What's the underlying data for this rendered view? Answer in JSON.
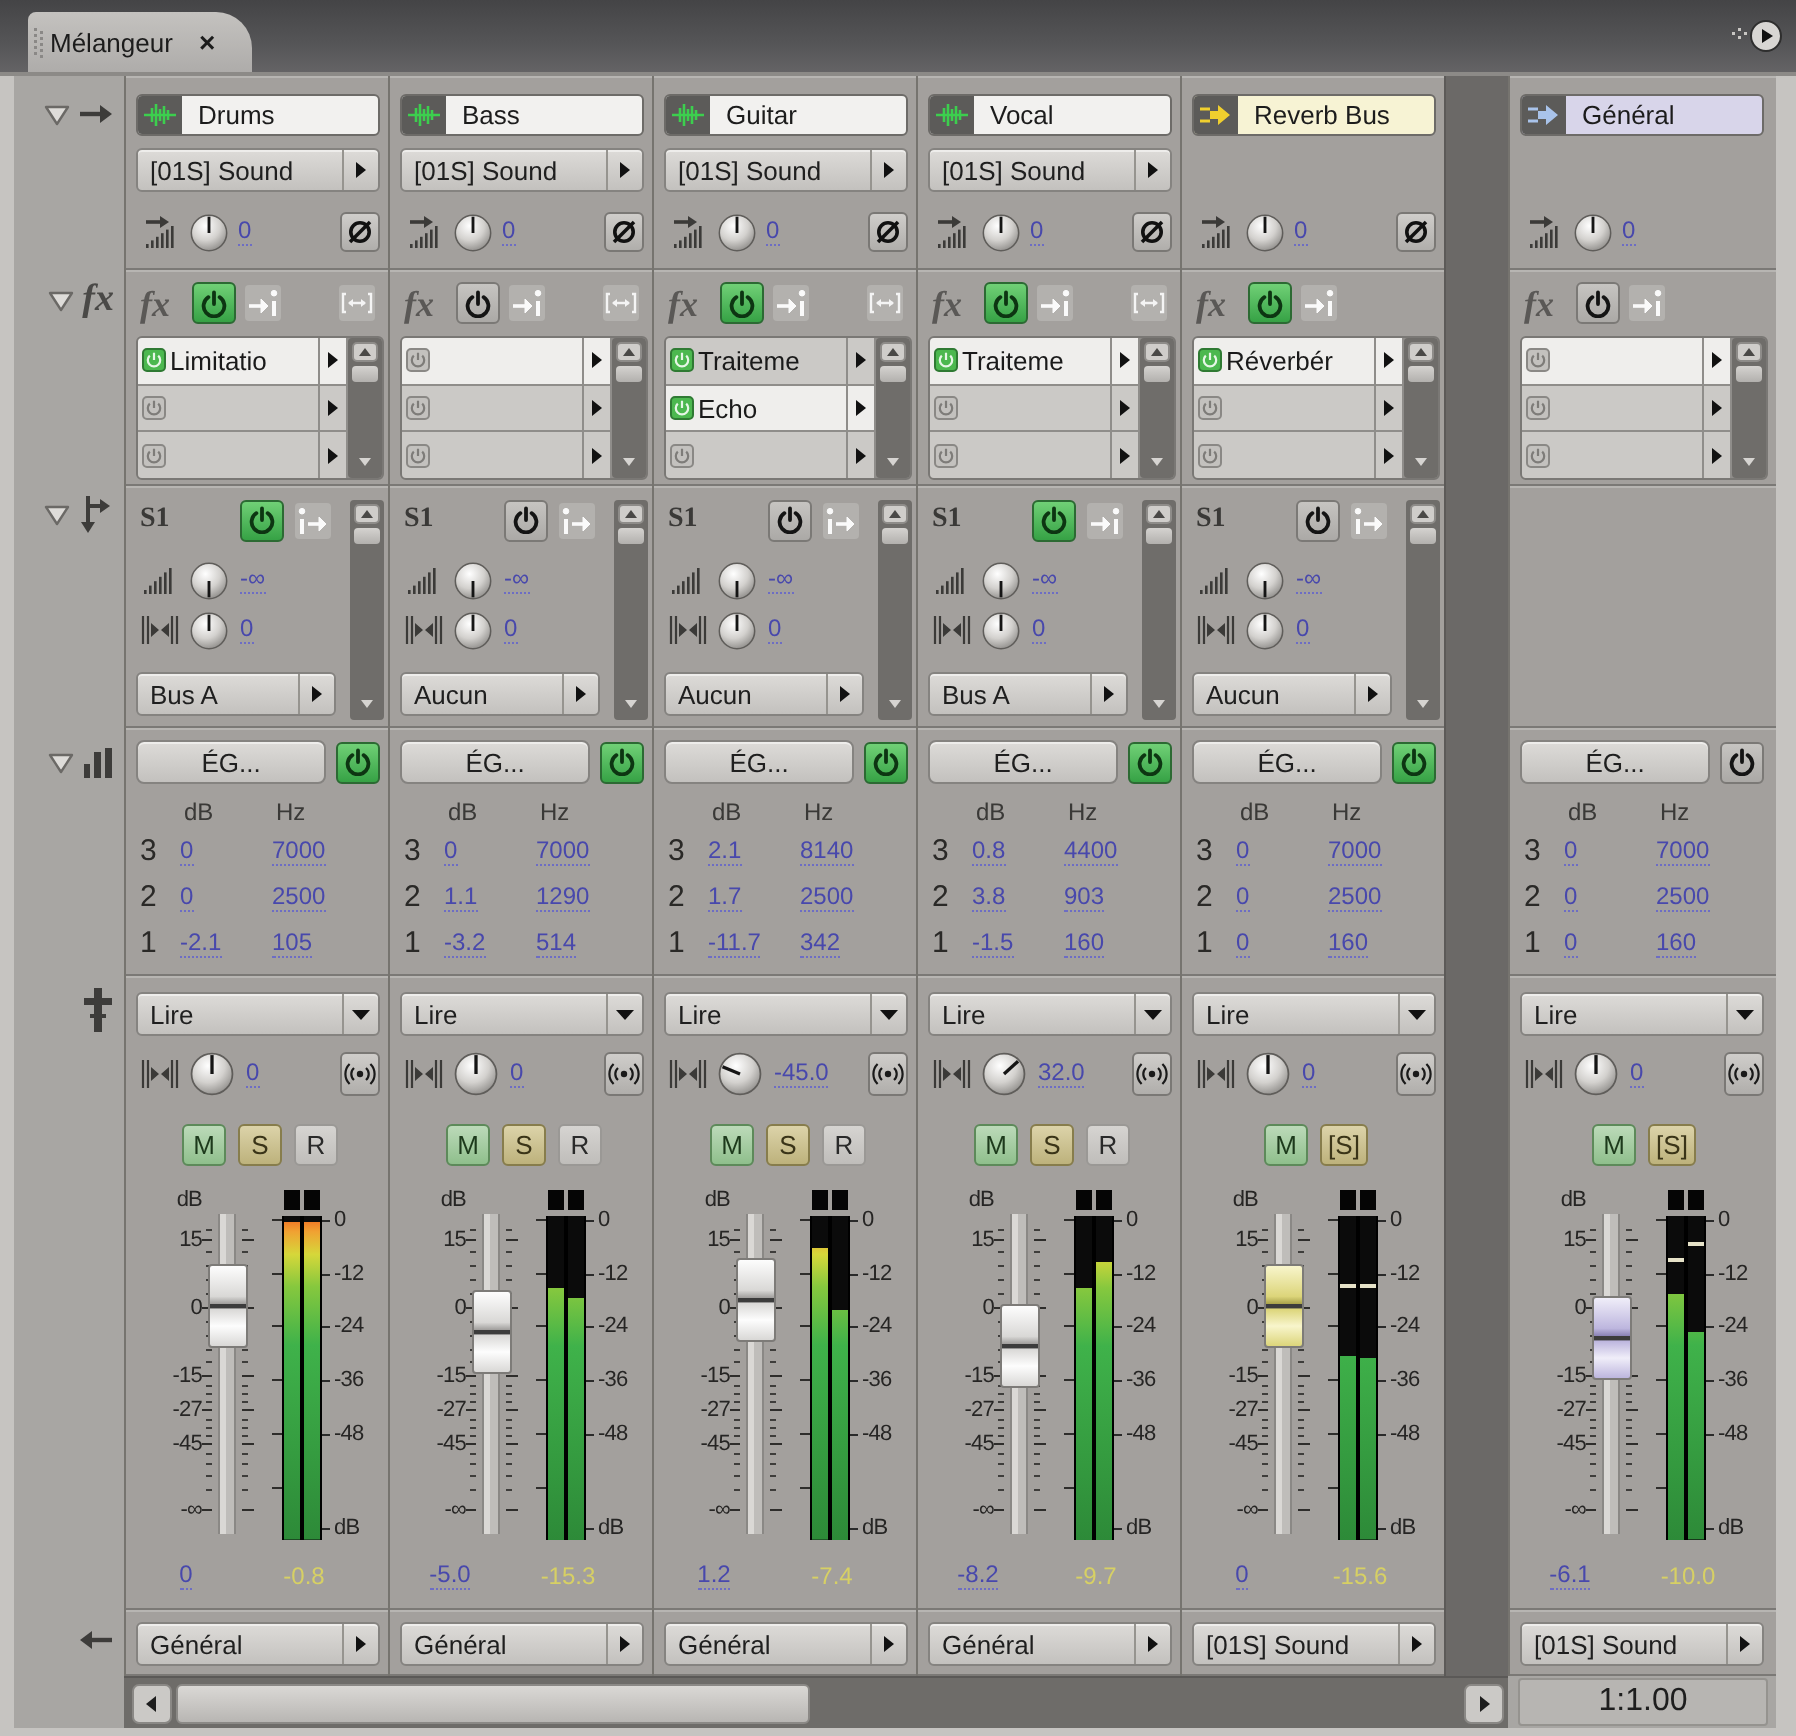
{
  "panel": {
    "tab": {
      "title": "Mélangeur",
      "close": "×",
      "selected": true
    }
  },
  "row_headers": [
    {
      "kind": "input",
      "expanded": true
    },
    {
      "kind": "effects",
      "label": "fx",
      "expanded": true
    },
    {
      "kind": "sends",
      "expanded": true
    },
    {
      "kind": "eq",
      "expanded": true
    },
    {
      "kind": "automation"
    },
    {
      "kind": "output"
    }
  ],
  "channels": [
    {
      "kind": "track",
      "name": "Drums",
      "input": "[01S] Sound",
      "gain": "0",
      "phase_invert": false,
      "fx": {
        "label": "fx",
        "power": true,
        "slots": [
          {
            "name": "Limitatio",
            "on": true,
            "selected": true
          },
          {
            "on": false,
            "selected": false
          },
          {
            "on": false,
            "selected": false
          }
        ]
      },
      "send": {
        "label": "S1",
        "power": true,
        "pre_fader": false,
        "volume": "-∞",
        "pan": "0",
        "bus": "Bus A"
      },
      "eq": {
        "label": "ÉG...",
        "power": true,
        "gain_header": "dB",
        "freq_header": "Hz",
        "bands": [
          {
            "band": "3",
            "gain": "0",
            "freq": "7000"
          },
          {
            "band": "2",
            "gain": "0",
            "freq": "2500"
          },
          {
            "band": "1",
            "gain": "-2.1",
            "freq": "105"
          }
        ]
      },
      "automation": "Lire",
      "pan": "0",
      "buttons": [
        {
          "kind": "mute",
          "label": "M"
        },
        {
          "kind": "solo",
          "label": "S"
        },
        {
          "kind": "record",
          "label": "R"
        }
      ],
      "fader": {
        "unit": "dB",
        "scale": [
          "15",
          "0",
          "-15",
          "-27",
          "-45",
          "-∞"
        ],
        "level": 0.71,
        "value": "0"
      },
      "meter": {
        "scale": [
          "0",
          "-12",
          "-24",
          "-36",
          "-48"
        ],
        "unit": "dB",
        "bars": [
          {
            "level": 0.98
          },
          {
            "level": 0.98
          }
        ],
        "peak": "-0.8"
      },
      "output": "Général"
    },
    {
      "kind": "track",
      "name": "Bass",
      "input": "[01S] Sound",
      "gain": "0",
      "phase_invert": false,
      "fx": {
        "label": "fx",
        "power": false,
        "slots": [
          {
            "on": false,
            "selected": true
          },
          {
            "on": false,
            "selected": false
          },
          {
            "on": false,
            "selected": false
          }
        ]
      },
      "send": {
        "label": "S1",
        "power": false,
        "pre_fader": false,
        "volume": "-∞",
        "pan": "0",
        "bus": "Aucun"
      },
      "eq": {
        "label": "ÉG...",
        "power": true,
        "gain_header": "dB",
        "freq_header": "Hz",
        "bands": [
          {
            "band": "3",
            "gain": "0",
            "freq": "7000"
          },
          {
            "band": "2",
            "gain": "1.1",
            "freq": "1290"
          },
          {
            "band": "1",
            "gain": "-3.2",
            "freq": "514"
          }
        ]
      },
      "automation": "Lire",
      "pan": "0",
      "buttons": [
        {
          "kind": "mute",
          "label": "M"
        },
        {
          "kind": "solo",
          "label": "S"
        },
        {
          "kind": "record",
          "label": "R"
        }
      ],
      "fader": {
        "unit": "dB",
        "scale": [
          "15",
          "0",
          "-15",
          "-27",
          "-45",
          "-∞"
        ],
        "level": 0.63,
        "value": "-5.0"
      },
      "meter": {
        "scale": [
          "0",
          "-12",
          "-24",
          "-36",
          "-48"
        ],
        "unit": "dB",
        "bars": [
          {
            "level": 0.78
          },
          {
            "level": 0.75
          }
        ],
        "peak": "-15.3"
      },
      "output": "Général"
    },
    {
      "kind": "track",
      "name": "Guitar",
      "input": "[01S] Sound",
      "gain": "0",
      "phase_invert": false,
      "fx": {
        "label": "fx",
        "power": true,
        "slots": [
          {
            "name": "Traiteme",
            "on": true,
            "selected": false
          },
          {
            "name": "Echo",
            "on": true,
            "selected": true
          },
          {
            "on": false,
            "selected": false
          }
        ]
      },
      "send": {
        "label": "S1",
        "power": false,
        "pre_fader": false,
        "volume": "-∞",
        "pan": "0",
        "bus": "Aucun"
      },
      "eq": {
        "label": "ÉG...",
        "power": true,
        "gain_header": "dB",
        "freq_header": "Hz",
        "bands": [
          {
            "band": "3",
            "gain": "2.1",
            "freq": "8140"
          },
          {
            "band": "2",
            "gain": "1.7",
            "freq": "2500"
          },
          {
            "band": "1",
            "gain": "-11.7",
            "freq": "342"
          }
        ]
      },
      "automation": "Lire",
      "pan": "-45.0",
      "buttons": [
        {
          "kind": "mute",
          "label": "M"
        },
        {
          "kind": "solo",
          "label": "S"
        },
        {
          "kind": "record",
          "label": "R"
        }
      ],
      "fader": {
        "unit": "dB",
        "scale": [
          "15",
          "0",
          "-15",
          "-27",
          "-45",
          "-∞"
        ],
        "level": 0.73,
        "value": "1.2"
      },
      "meter": {
        "scale": [
          "0",
          "-12",
          "-24",
          "-36",
          "-48"
        ],
        "unit": "dB",
        "bars": [
          {
            "level": 0.9
          },
          {
            "level": 0.71
          }
        ],
        "peak": "-7.4"
      },
      "output": "Général"
    },
    {
      "kind": "track",
      "name": "Vocal",
      "input": "[01S] Sound",
      "gain": "0",
      "phase_invert": false,
      "fx": {
        "label": "fx",
        "power": true,
        "slots": [
          {
            "name": "Traiteme",
            "on": true,
            "selected": true
          },
          {
            "on": false,
            "selected": false
          },
          {
            "on": false,
            "selected": false
          }
        ]
      },
      "send": {
        "label": "S1",
        "power": true,
        "pre_fader": true,
        "volume": "-∞",
        "pan": "0",
        "bus": "Bus A"
      },
      "eq": {
        "label": "ÉG...",
        "power": true,
        "gain_header": "dB",
        "freq_header": "Hz",
        "bands": [
          {
            "band": "3",
            "gain": "0.8",
            "freq": "4400"
          },
          {
            "band": "2",
            "gain": "3.8",
            "freq": "903"
          },
          {
            "band": "1",
            "gain": "-1.5",
            "freq": "160"
          }
        ]
      },
      "automation": "Lire",
      "pan": "32.0",
      "buttons": [
        {
          "kind": "mute",
          "label": "M"
        },
        {
          "kind": "solo",
          "label": "S"
        },
        {
          "kind": "record",
          "label": "R"
        }
      ],
      "fader": {
        "unit": "dB",
        "scale": [
          "15",
          "0",
          "-15",
          "-27",
          "-45",
          "-∞"
        ],
        "level": 0.59,
        "value": "-8.2"
      },
      "meter": {
        "scale": [
          "0",
          "-12",
          "-24",
          "-36",
          "-48"
        ],
        "unit": "dB",
        "bars": [
          {
            "level": 0.78
          },
          {
            "level": 0.86
          }
        ],
        "peak": "-9.7"
      },
      "output": "Général"
    },
    {
      "kind": "bus",
      "name": "Reverb Bus",
      "gain": "0",
      "phase_invert": false,
      "fx": {
        "label": "fx",
        "power": true,
        "slots": [
          {
            "name": "Réverbér",
            "on": true,
            "selected": true
          },
          {
            "on": false,
            "selected": false
          },
          {
            "on": false,
            "selected": false
          }
        ]
      },
      "send": {
        "label": "S1",
        "power": false,
        "pre_fader": false,
        "volume": "-∞",
        "pan": "0",
        "bus": "Aucun"
      },
      "eq": {
        "label": "ÉG...",
        "power": true,
        "gain_header": "dB",
        "freq_header": "Hz",
        "bands": [
          {
            "band": "3",
            "gain": "0",
            "freq": "7000"
          },
          {
            "band": "2",
            "gain": "0",
            "freq": "2500"
          },
          {
            "band": "1",
            "gain": "0",
            "freq": "160"
          }
        ]
      },
      "automation": "Lire",
      "pan": "0",
      "buttons": [
        {
          "kind": "mute",
          "label": "M"
        },
        {
          "kind": "solo",
          "label": "[S]"
        }
      ],
      "fader": {
        "unit": "dB",
        "scale": [
          "15",
          "0",
          "-15",
          "-27",
          "-45",
          "-∞"
        ],
        "level": 0.71,
        "value": "0"
      },
      "meter": {
        "scale": [
          "0",
          "-12",
          "-24",
          "-36",
          "-48"
        ],
        "unit": "dB",
        "bars": [
          {
            "level": 0.57,
            "hold": {
              "level": 0.78
            }
          },
          {
            "level": 0.56,
            "hold": {
              "level": 0.78
            }
          }
        ],
        "peak": "-15.6"
      },
      "output": "[01S] Sound"
    },
    {
      "kind": "master",
      "name": "Général",
      "gain": "0",
      "fx": {
        "label": "fx",
        "power": false,
        "slots": [
          {
            "on": false,
            "selected": true
          },
          {
            "on": false,
            "selected": false
          },
          {
            "on": false,
            "selected": false
          }
        ]
      },
      "eq": {
        "label": "ÉG...",
        "power": false,
        "gain_header": "dB",
        "freq_header": "Hz",
        "bands": [
          {
            "band": "3",
            "gain": "0",
            "freq": "7000"
          },
          {
            "band": "2",
            "gain": "0",
            "freq": "2500"
          },
          {
            "band": "1",
            "gain": "0",
            "freq": "160"
          }
        ]
      },
      "automation": "Lire",
      "pan": "0",
      "buttons": [
        {
          "kind": "mute",
          "label": "M"
        },
        {
          "kind": "solo",
          "label": "[S]"
        }
      ],
      "fader": {
        "unit": "dB",
        "scale": [
          "15",
          "0",
          "-15",
          "-27",
          "-45",
          "-∞"
        ],
        "level": 0.61,
        "value": "-6.1"
      },
      "meter": {
        "scale": [
          "0",
          "-12",
          "-24",
          "-36",
          "-48"
        ],
        "unit": "dB",
        "bars": [
          {
            "level": 0.76,
            "hold": {
              "level": 0.86
            }
          },
          {
            "level": 0.64,
            "hold": {
              "level": 0.91
            }
          }
        ],
        "peak": "-10.0"
      },
      "output": "[01S] Sound"
    }
  ],
  "zoom": "1:1.00"
}
